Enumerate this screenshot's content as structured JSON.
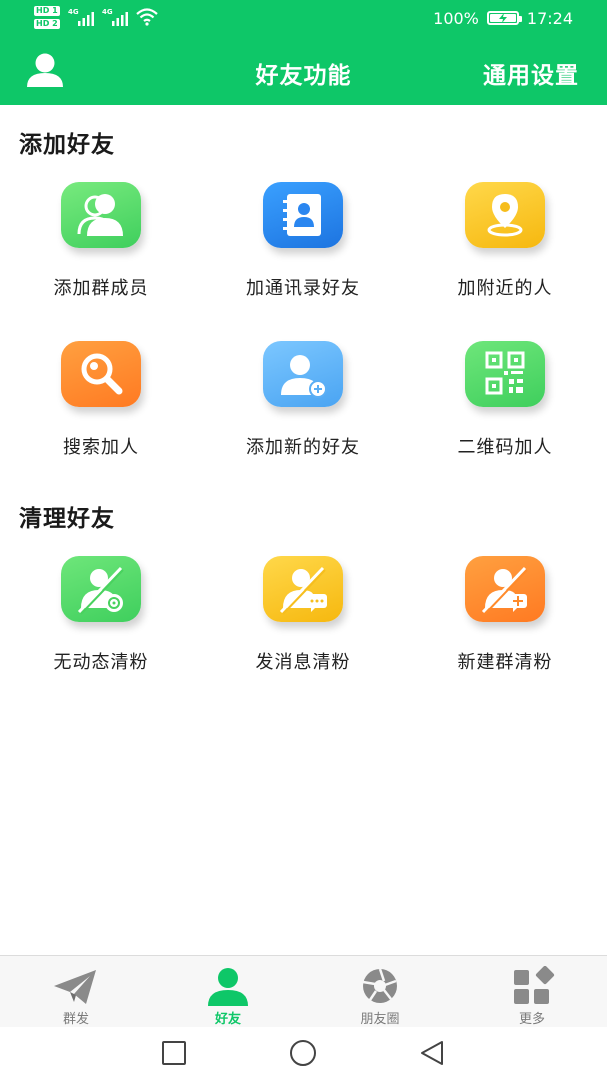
{
  "status_bar": {
    "hd1": "HD 1",
    "hd2": "HD 2",
    "net1": "4G",
    "net2": "4G",
    "battery_text": "100%",
    "battery_level": 1.0,
    "time": "17:24",
    "icons": [
      "signal-icon",
      "wifi-icon",
      "battery-charging-icon"
    ]
  },
  "header": {
    "title": "好友功能",
    "settings_label": "通用设置",
    "avatar_icon": "user-icon"
  },
  "sections": [
    {
      "title": "添加好友",
      "items": [
        {
          "label": "添加群成员",
          "icon": "group-members-icon",
          "color": "#56d96a"
        },
        {
          "label": "加通讯录好友",
          "icon": "contacts-book-icon",
          "color": "#2d8cf0"
        },
        {
          "label": "加附近的人",
          "icon": "location-pin-icon",
          "color": "#f7c21e"
        },
        {
          "label": "搜索加人",
          "icon": "search-icon",
          "color": "#ff8a2a"
        },
        {
          "label": "添加新的好友",
          "icon": "add-user-icon",
          "color": "#5ab3f7"
        },
        {
          "label": "二维码加人",
          "icon": "qr-code-icon",
          "color": "#4fd96b"
        }
      ]
    },
    {
      "title": "清理好友",
      "items": [
        {
          "label": "无动态清粉",
          "icon": "no-moments-clean-icon",
          "color": "#4fd96b"
        },
        {
          "label": "发消息清粉",
          "icon": "message-clean-icon",
          "color": "#f7c21e"
        },
        {
          "label": "新建群清粉",
          "icon": "new-group-clean-icon",
          "color": "#ff8a2a"
        }
      ]
    }
  ],
  "tabbar": {
    "active": 1,
    "active_color": "#0ec768",
    "tabs": [
      {
        "label": "群发",
        "icon": "paper-plane-icon"
      },
      {
        "label": "好友",
        "icon": "user-icon"
      },
      {
        "label": "朋友圈",
        "icon": "aperture-icon"
      },
      {
        "label": "更多",
        "icon": "more-grid-icon"
      }
    ]
  },
  "system_nav": {
    "icons": [
      "recents-square-icon",
      "home-circle-icon",
      "back-triangle-icon"
    ]
  }
}
